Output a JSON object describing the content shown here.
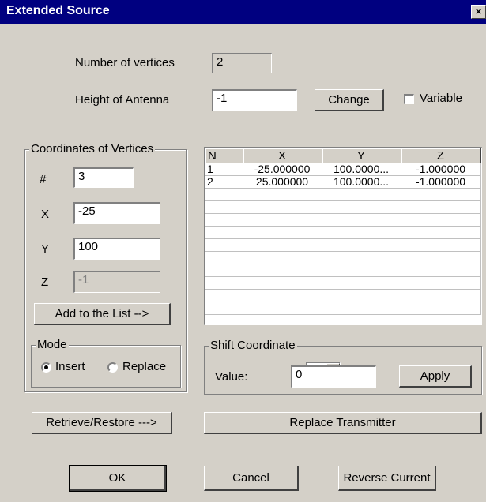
{
  "window": {
    "title": "Extended Source",
    "close_glyph": "×"
  },
  "vertices": {
    "label": "Number of vertices",
    "value": "2"
  },
  "antenna": {
    "label": "Height of Antenna",
    "value": "-1",
    "change_label": "Change",
    "variable_label": "Variable",
    "variable_checked": false
  },
  "coords": {
    "legend": "Coordinates of Vertices",
    "index_label": "#",
    "index_value": "3",
    "x_label": "X",
    "x_value": "-25",
    "y_label": "Y",
    "y_value": "100",
    "z_label": "Z",
    "z_value": "-1",
    "add_label": "Add to the List -->"
  },
  "mode": {
    "legend": "Mode",
    "insert_label": "Insert",
    "replace_label": "Replace",
    "selected": "Insert"
  },
  "grid": {
    "headers": [
      "N",
      "X",
      "Y",
      "Z"
    ],
    "rows": [
      [
        "1",
        "-25.000000",
        "100.0000...",
        "-1.000000"
      ],
      [
        "2",
        "25.000000",
        "100.0000...",
        "-1.000000"
      ]
    ]
  },
  "shift": {
    "legend": "Shift Coordinate",
    "axis": "X",
    "value_label": "Value:",
    "value": "0",
    "apply_label": "Apply"
  },
  "buttons": {
    "retrieve": "Retrieve/Restore --->",
    "replace_transmitter": "Replace Transmitter",
    "ok": "OK",
    "cancel": "Cancel",
    "reverse": "Reverse Current"
  }
}
